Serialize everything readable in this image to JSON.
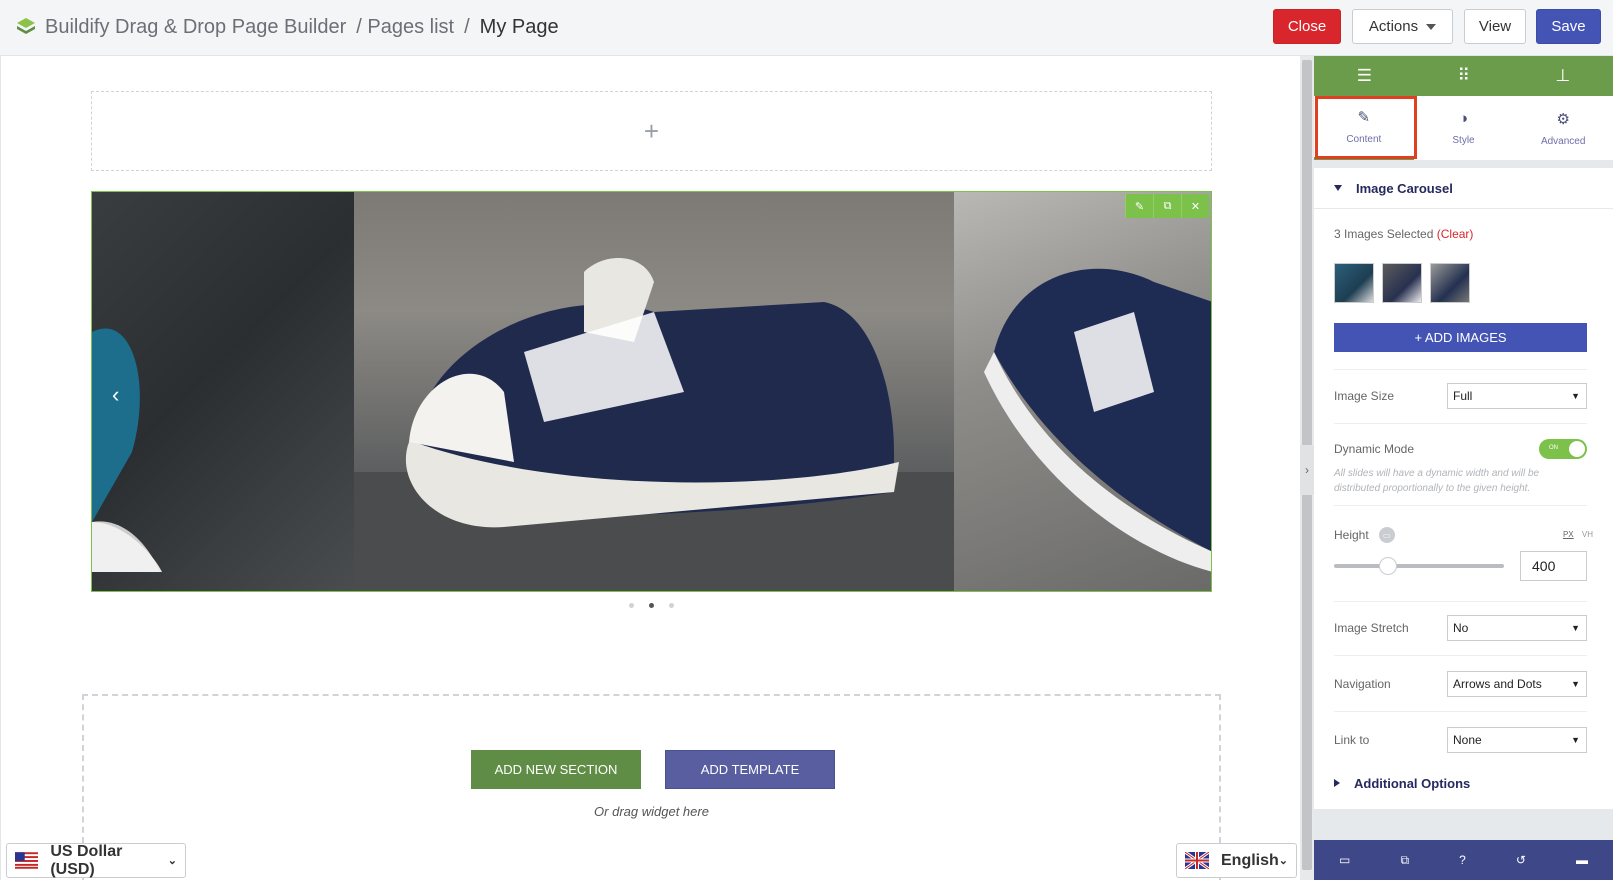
{
  "header": {
    "breadcrumbs": [
      "Buildify Drag & Drop Page Builder",
      "/ Pages list",
      "/",
      "My Page"
    ],
    "buttons": {
      "close": "Close",
      "actions": "Actions",
      "view": "View",
      "save": "Save"
    }
  },
  "canvas": {
    "empty_section_icon": "+",
    "carousel": {
      "prev_arrow": "‹",
      "dot_count": 3,
      "active_dot": 2
    },
    "drop_area": {
      "add_section": "ADD NEW SECTION",
      "add_template": "ADD TEMPLATE",
      "hint": "Or drag widget here"
    }
  },
  "panel": {
    "tabs": [
      "Content",
      "Style",
      "Advanced"
    ],
    "section_title": "Image Carousel",
    "images_selected": "3 Images Selected",
    "clear_label": "(Clear)",
    "add_images": "+ ADD IMAGES",
    "fields": {
      "image_size": {
        "label": "Image Size",
        "value": "Full"
      },
      "dynamic_mode": {
        "label": "Dynamic Mode",
        "state": "ON"
      },
      "dynamic_hint": "All slides will have a dynamic width and will be distributed proportionally to the given height.",
      "height": {
        "label": "Height",
        "value": "400",
        "unit_px": "PX",
        "unit_vh": "VH",
        "slider_fraction": 0.32
      },
      "image_stretch": {
        "label": "Image Stretch",
        "value": "No"
      },
      "navigation": {
        "label": "Navigation",
        "value": "Arrows and Dots"
      },
      "link_to": {
        "label": "Link to",
        "value": "None"
      }
    },
    "additional_options": "Additional Options"
  },
  "footer": {
    "currency": "US Dollar (USD)",
    "language": "English"
  },
  "colors": {
    "accent_green": "#6a9c4b",
    "save_blue": "#4454b5",
    "close_red": "#d9262c",
    "panel_navy": "#3e4787"
  }
}
